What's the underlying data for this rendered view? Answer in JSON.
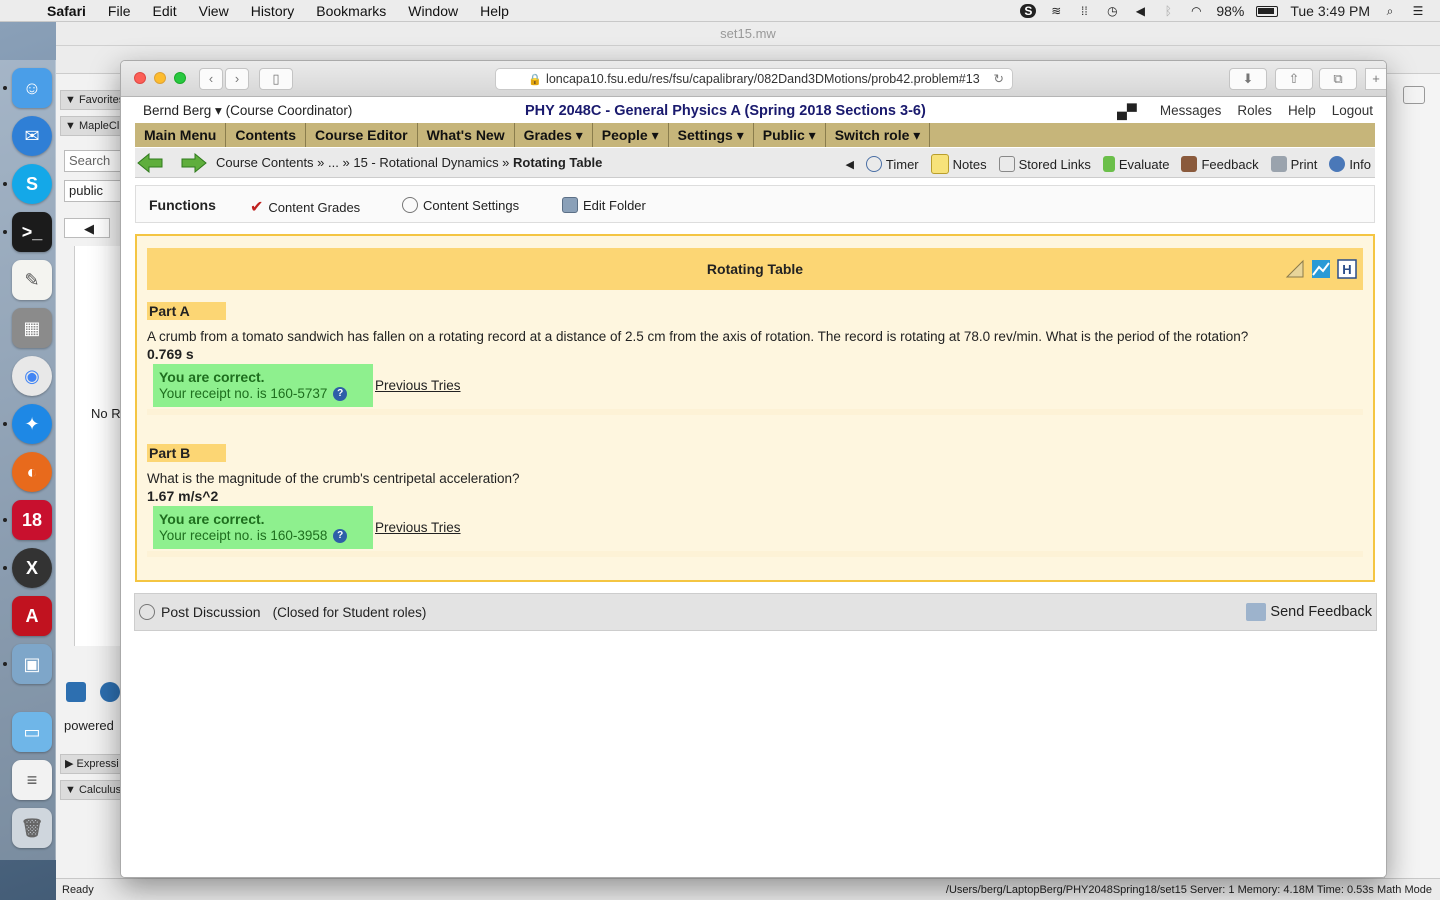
{
  "menubar": {
    "app": "Safari",
    "items": [
      "File",
      "Edit",
      "View",
      "History",
      "Bookmarks",
      "Window",
      "Help"
    ],
    "battery": "98%",
    "clock": "Tue 3:49 PM"
  },
  "maple": {
    "title": "set15.mw",
    "side": {
      "favorites": "Favorites",
      "maplecl": "MapleCl",
      "search_placeholder": "Search",
      "public": "public",
      "no_r": "No R",
      "powered": "powered",
      "expressions": "Expressi",
      "calculus": "Calculus"
    },
    "status_left": "Ready",
    "status_right": "/Users/berg/LaptopBerg/PHY2048Spring18/set15   Server: 1   Memory: 4.18M   Time: 0.53s   Math Mode"
  },
  "safari": {
    "url": "loncapa10.fsu.edu/res/fsu/capalibrary/082Dand3DMotions/prob42.problem#13"
  },
  "header": {
    "user": "Bernd Berg",
    "role": "(Course Coordinator)",
    "course": "PHY 2048C - General Physics A (Spring 2018 Sections 3-6)",
    "links": [
      "Messages",
      "Roles",
      "Help",
      "Logout"
    ]
  },
  "mainmenu": [
    "Main Menu",
    "Contents",
    "Course Editor",
    "What's New",
    "Grades ▾",
    "People ▾",
    "Settings ▾",
    "Public ▾",
    "Switch role ▾"
  ],
  "breadcrumb": {
    "a": "Course Contents »",
    "b": "... »",
    "c": "15 - Rotational Dynamics »",
    "current": "Rotating Table"
  },
  "tools": {
    "timer": "Timer",
    "notes": "Notes",
    "stored_links": "Stored Links",
    "evaluate": "Evaluate",
    "feedback": "Feedback",
    "print": "Print",
    "info": "Info"
  },
  "functions": {
    "label": "Functions",
    "content_grades": "Content Grades",
    "content_settings": "Content Settings",
    "edit_folder": "Edit Folder"
  },
  "problem": {
    "title": "Rotating Table",
    "parts": [
      {
        "heading": "Part A",
        "question": "A crumb from a tomato sandwich has fallen on a rotating record at a distance of 2.5 cm from the axis of rotation. The record is rotating at 78.0 rev/min. What is the period of the rotation?",
        "answer": "0.769 s",
        "status": "You are correct.",
        "receipt": "Your receipt no. is 160-5737",
        "prev": "Previous Tries"
      },
      {
        "heading": "Part B",
        "question": "What is the magnitude of the crumb's centripetal acceleration?",
        "answer": "1.67 m/s^2",
        "status": "You are correct.",
        "receipt": "Your receipt no. is 160-3958",
        "prev": "Previous Tries"
      }
    ]
  },
  "discussion": {
    "post": "Post Discussion",
    "note": "(Closed for Student roles)",
    "send": "Send Feedback"
  }
}
